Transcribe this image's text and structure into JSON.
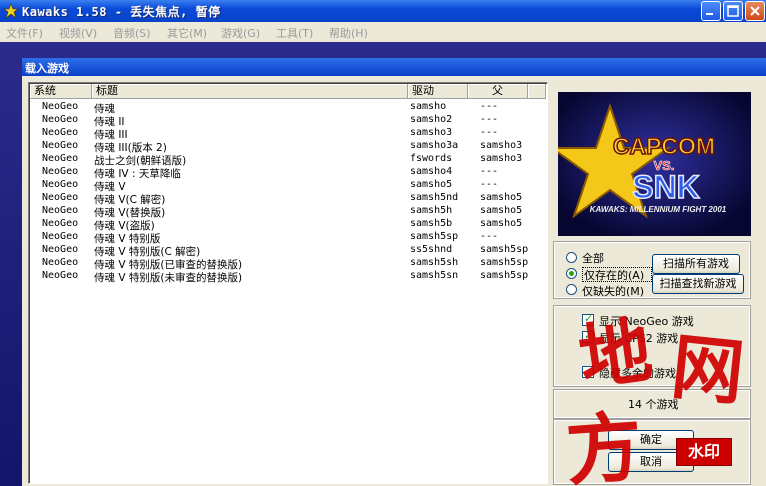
{
  "window": {
    "title": "Kawaks 1.58 - 丢失焦点, 暂停"
  },
  "menu": [
    "文件(F)",
    "视频(V)",
    "音频(S)",
    "其它(M)",
    "游戏(G)",
    "工具(T)",
    "帮助(H)"
  ],
  "dialog": {
    "title": "载入游戏"
  },
  "list": {
    "columns": [
      "系统",
      "标题",
      "驱动",
      "父"
    ],
    "rows": [
      {
        "system": "NeoGeo",
        "title": "侍魂",
        "driver": "samsho",
        "parent": "---"
      },
      {
        "system": "NeoGeo",
        "title": "侍魂 II",
        "driver": "samsho2",
        "parent": "---"
      },
      {
        "system": "NeoGeo",
        "title": "侍魂 III",
        "driver": "samsho3",
        "parent": "---"
      },
      {
        "system": "NeoGeo",
        "title": "侍魂 III(版本 2)",
        "driver": "samsho3a",
        "parent": "samsho3"
      },
      {
        "system": "NeoGeo",
        "title": "战士之剑(朝鲜语版)",
        "driver": "fswords",
        "parent": "samsho3"
      },
      {
        "system": "NeoGeo",
        "title": "侍魂 IV : 天草降临",
        "driver": "samsho4",
        "parent": "---"
      },
      {
        "system": "NeoGeo",
        "title": "侍魂 V",
        "driver": "samsho5",
        "parent": "---"
      },
      {
        "system": "NeoGeo",
        "title": "侍魂 V(C 解密)",
        "driver": "samsh5nd",
        "parent": "samsho5"
      },
      {
        "system": "NeoGeo",
        "title": "侍魂 V(替换版)",
        "driver": "samsh5h",
        "parent": "samsho5"
      },
      {
        "system": "NeoGeo",
        "title": "侍魂 V(盗版)",
        "driver": "samsh5b",
        "parent": "samsho5"
      },
      {
        "system": "NeoGeo",
        "title": "侍魂 V 特别版",
        "driver": "samsh5sp",
        "parent": "---"
      },
      {
        "system": "NeoGeo",
        "title": "侍魂 V 特别版(C 解密)",
        "driver": "ss5shnd",
        "parent": "samsh5sp"
      },
      {
        "system": "NeoGeo",
        "title": "侍魂 V 特别版(已审查的替换版)",
        "driver": "samsh5sh",
        "parent": "samsh5sp"
      },
      {
        "system": "NeoGeo",
        "title": "侍魂 V 特别版(未审查的替换版)",
        "driver": "samsh5sn",
        "parent": "samsh5sp"
      }
    ]
  },
  "preview": {
    "logo_top": "CAPCOM",
    "logo_vs": "VS.",
    "logo_bottom": "SNK",
    "tagline": "KAWAKS: MILLENNIUM FIGHT 2001"
  },
  "filter": {
    "options": [
      "全部",
      "仅存在的(A)",
      "仅缺失的(M)"
    ],
    "selected_index": 1,
    "scan_all_label": "扫描所有游戏",
    "scan_new_label": "扫描查找新游戏"
  },
  "display_options": {
    "show_neogeo": "显示 NeoGeo 游戏",
    "show_cps2": "显示 CPS2 游戏",
    "hide_extra": "隐藏多余的游戏"
  },
  "count_text": "14 个游戏",
  "actions": {
    "ok_label": "确定",
    "cancel_label": "取消"
  },
  "watermark": {
    "text": "地方网",
    "stamp": "水印"
  },
  "colors": {
    "titlebar_blue": "#0a4ad8",
    "dialog_bg": "#ece9d8",
    "watermark_red": "#d00000"
  }
}
